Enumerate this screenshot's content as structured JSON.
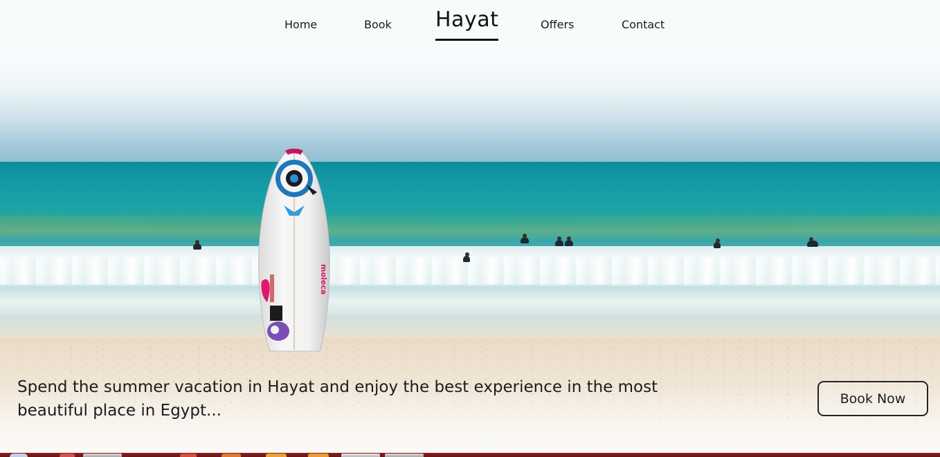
{
  "nav": {
    "items": [
      {
        "label": "Home"
      },
      {
        "label": "Book"
      },
      {
        "label": "Offers"
      },
      {
        "label": "Contact"
      }
    ],
    "brand": "Hayat"
  },
  "hero": {
    "tagline": "Spend the summer vacation in Hayat and enjoy the best experience in the most beautiful place in Egypt...",
    "cta_label": "Book Now"
  },
  "surfboard": {
    "brand_text": "moleca"
  },
  "colors": {
    "text": "#1c1c1c",
    "sea": "#169aa5",
    "sand": "#efe3d2",
    "taskbar": "#7a1a1a"
  }
}
